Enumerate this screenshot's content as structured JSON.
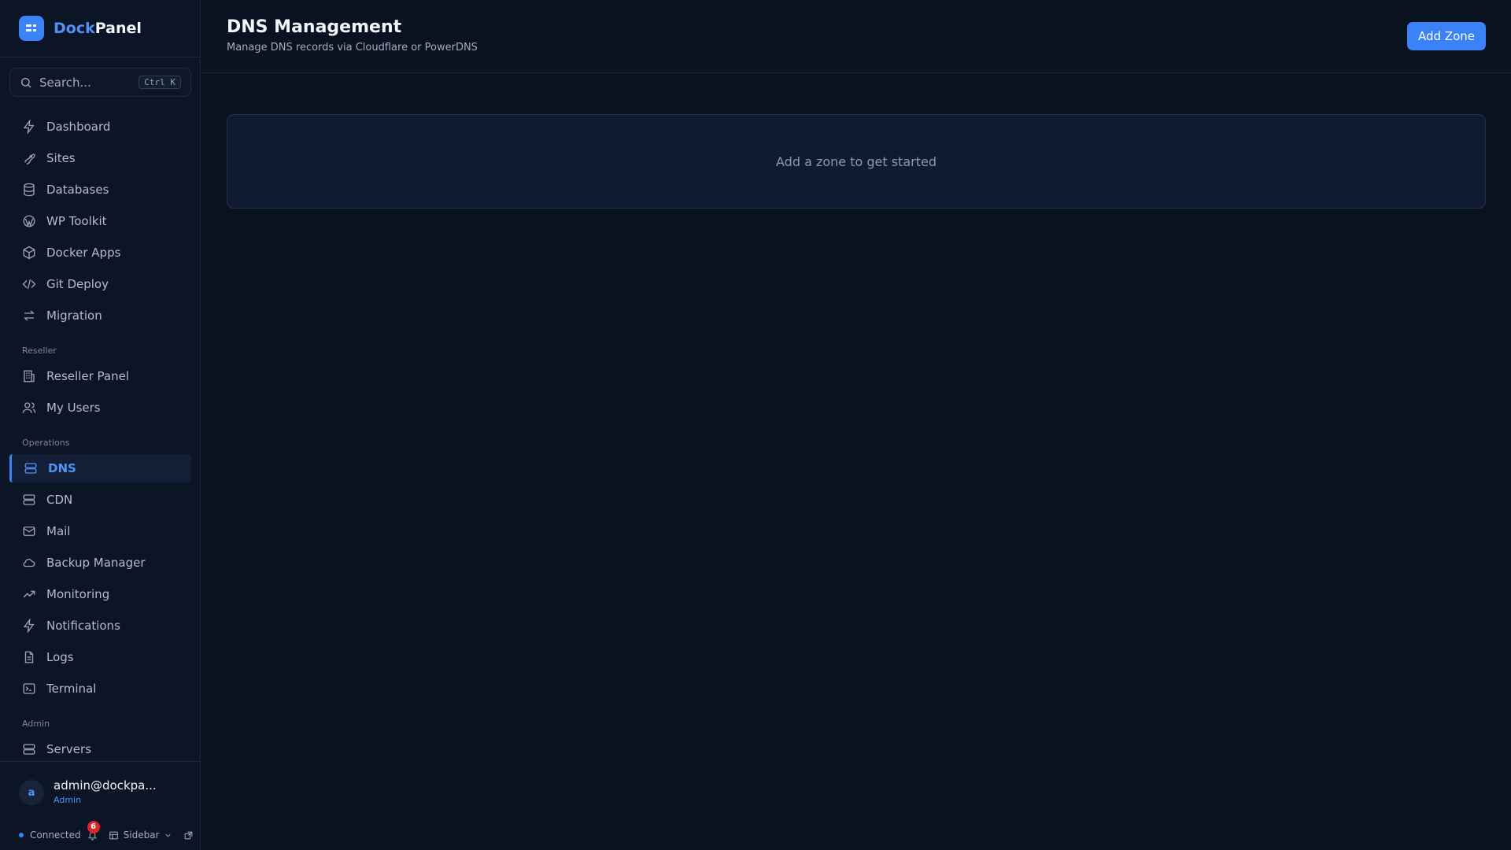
{
  "brand": {
    "name_part1": "Dock",
    "name_part2": "Panel"
  },
  "search": {
    "placeholder": "Search...",
    "shortcut": "Ctrl K"
  },
  "sidebar": {
    "items": [
      {
        "label": "Dashboard",
        "icon": "lightning-icon"
      },
      {
        "label": "Sites",
        "icon": "rocket-icon"
      },
      {
        "label": "Databases",
        "icon": "database-icon"
      },
      {
        "label": "WP Toolkit",
        "icon": "wordpress-icon"
      },
      {
        "label": "Docker Apps",
        "icon": "box-icon"
      },
      {
        "label": "Git Deploy",
        "icon": "code-icon"
      },
      {
        "label": "Migration",
        "icon": "arrows-swap-icon"
      }
    ],
    "reseller_heading": "Reseller",
    "reseller_items": [
      {
        "label": "Reseller Panel",
        "icon": "building-icon"
      },
      {
        "label": "My Users",
        "icon": "users-icon"
      }
    ],
    "operations_heading": "Operations",
    "operations_items": [
      {
        "label": "DNS",
        "icon": "server-icon",
        "active": true
      },
      {
        "label": "CDN",
        "icon": "server-icon"
      },
      {
        "label": "Mail",
        "icon": "mail-icon"
      },
      {
        "label": "Backup Manager",
        "icon": "cloud-icon"
      },
      {
        "label": "Monitoring",
        "icon": "trending-up-icon"
      },
      {
        "label": "Notifications",
        "icon": "lightning-icon"
      },
      {
        "label": "Logs",
        "icon": "file-icon"
      },
      {
        "label": "Terminal",
        "icon": "terminal-icon"
      }
    ],
    "admin_heading": "Admin",
    "admin_items": [
      {
        "label": "Servers",
        "icon": "server-icon"
      }
    ]
  },
  "user": {
    "initial": "a",
    "email": "admin@dockpa...",
    "role": "Admin"
  },
  "status": {
    "connection": "Connected",
    "notification_count": "6",
    "layout_label": "Sidebar"
  },
  "header": {
    "title": "DNS Management",
    "subtitle": "Manage DNS records via Cloudflare or PowerDNS",
    "add_button": "Add Zone"
  },
  "empty_state": {
    "message": "Add a zone to get started"
  },
  "colors": {
    "accent": "#3b82f6",
    "background": "#0a1120",
    "sidebar": "#0c1526",
    "badge": "#dc2626"
  }
}
